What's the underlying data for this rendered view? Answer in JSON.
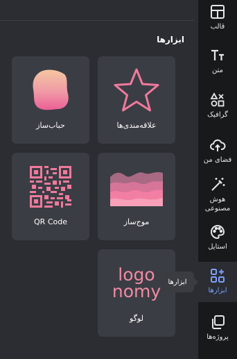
{
  "rail": {
    "items": [
      {
        "label": "قالب",
        "icon": "layout-icon"
      },
      {
        "label": "متن",
        "icon": "text-icon"
      },
      {
        "label": "گرافیک",
        "icon": "shapes-icon"
      },
      {
        "label": "فضای من",
        "icon": "cloud-upload-icon"
      },
      {
        "label": "هوش\nمصنوعی",
        "icon": "magic-wand-icon"
      },
      {
        "label": "استایل",
        "icon": "palette-icon"
      },
      {
        "label": "ابزارها",
        "icon": "apps-add-icon"
      },
      {
        "label": "پروژه‌ها",
        "icon": "projects-icon"
      }
    ]
  },
  "panel": {
    "title": "ابزارها",
    "tiles": [
      {
        "label": "علاقه‌مندی‌ها",
        "icon": "star-icon"
      },
      {
        "label": "حباب‌ساز",
        "icon": "blob-icon"
      },
      {
        "label": "موج‌ساز",
        "icon": "wave-icon"
      },
      {
        "label": "QR Code",
        "icon": "qr-code-icon"
      },
      {
        "label": "لوگو",
        "icon": "logo-icon",
        "art_line1": "logo",
        "art_line2": "nomy"
      }
    ]
  },
  "tooltip": {
    "text": "ابزارها"
  },
  "colors": {
    "accent": "#7da2ff",
    "pink": "#f07a9c",
    "panel_bg": "#2b2d33",
    "tile_bg": "#3b3d44",
    "rail_bg": "#18191b"
  }
}
